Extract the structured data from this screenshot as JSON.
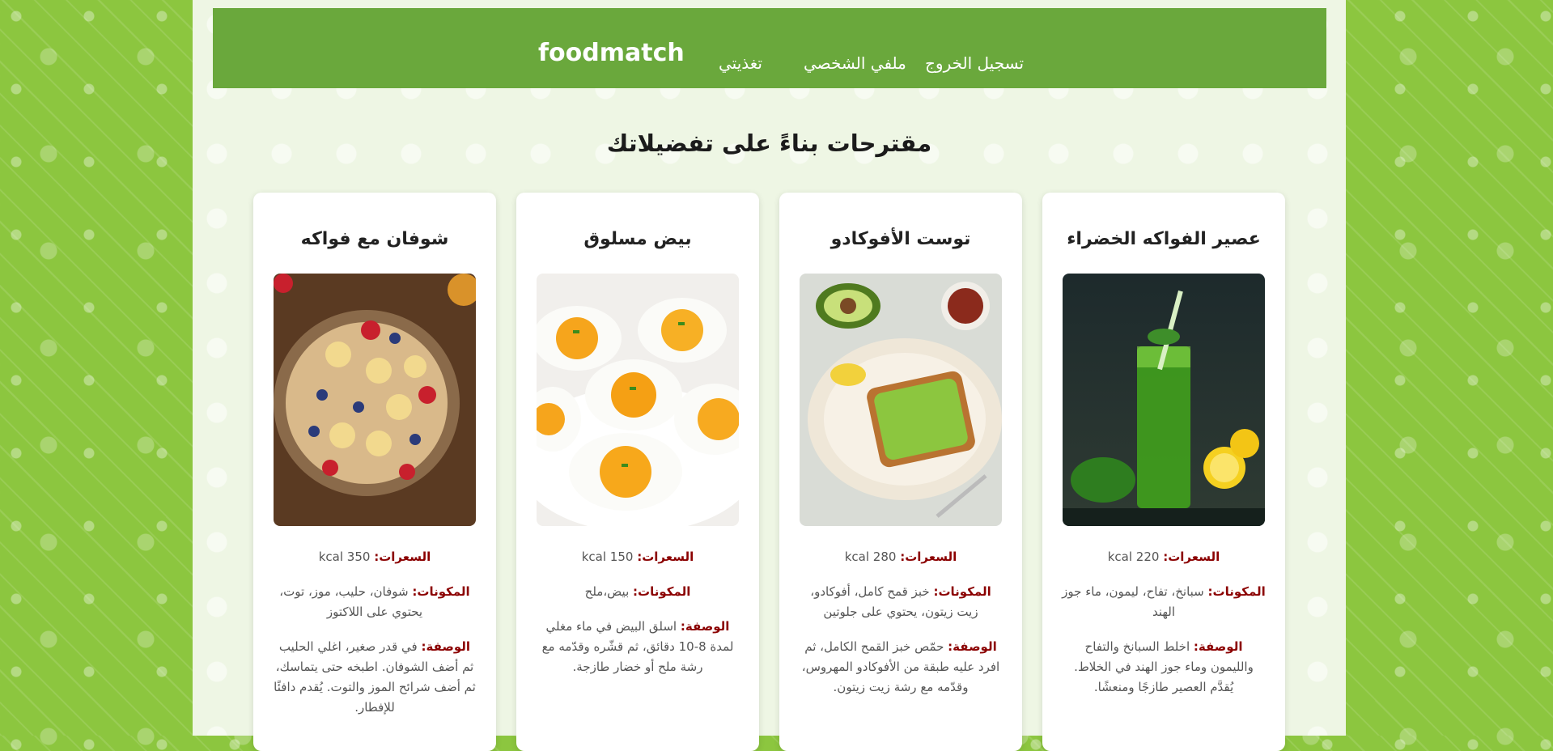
{
  "nav": {
    "brand": "foodmatch",
    "links": [
      "تسجيل الخروج",
      "ملفي الشخصي",
      "تغذيتي"
    ]
  },
  "page_title": "مقترحات بناءً على تفضيلاتك",
  "labels": {
    "calories": "السعرات:",
    "ingredients": "المكونات:",
    "description": "الوصفة:"
  },
  "cards": [
    {
      "title": "عصير الفواكه الخضراء",
      "calories": "220 kcal",
      "ingredients": "سبانخ، تفاح، ليمون، ماء جوز الهند",
      "description": "اخلط السبانخ والتفاح والليمون وماء جوز الهند في الخلاط. يُقدَّم العصير طازجًا ومنعشًا.",
      "image_icon": "green-juice-image"
    },
    {
      "title": "توست الأفوكادو",
      "calories": "280 kcal",
      "ingredients": "خبز قمح كامل، أفوكادو، زيت زيتون، يحتوي على جلوتين",
      "description": "حمّص خبز القمح الكامل، ثم افرد عليه طبقة من الأفوكادو المهروس، وقدّمه مع رشة زيت زيتون.",
      "image_icon": "avocado-toast-image"
    },
    {
      "title": "بيض مسلوق",
      "calories": "150 kcal",
      "ingredients": "بيض،ملح",
      "description": "اسلق البيض في ماء مغلي لمدة 8-10 دقائق، ثم قشّره وقدّمه مع رشة ملح أو خضار طازجة.",
      "image_icon": "boiled-eggs-image"
    },
    {
      "title": "شوفان مع فواكه",
      "calories": "350 kcal",
      "ingredients": "شوفان، حليب، موز، توت، يحتوي على اللاكتوز",
      "description": "في قدر صغير، اغلي الحليب ثم أضف الشوفان. اطبخه حتى يتماسك، ثم أضف شرائح الموز والتوت. يُقدم دافئًا للإفطار.",
      "image_icon": "oatmeal-fruit-image"
    }
  ]
}
